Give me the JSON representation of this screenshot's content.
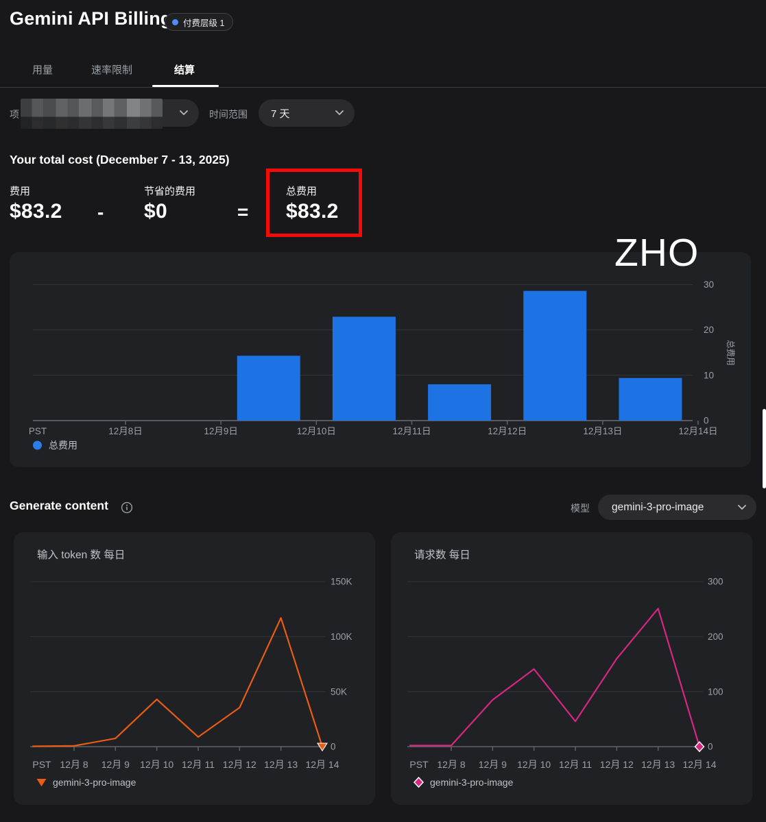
{
  "header": {
    "title": "Gemini API Billing",
    "badge_label": "付费层级 1",
    "badge_dot_color": "#4f8df7"
  },
  "tabs": [
    {
      "label": "用量",
      "active": false
    },
    {
      "label": "速率限制",
      "active": false
    },
    {
      "label": "结算",
      "active": true
    }
  ],
  "filters": {
    "project_label": "项目",
    "time_range_label": "时间范围",
    "time_range_value": "7 天"
  },
  "total_cost": {
    "heading": "Your total cost (December 7 - 13, 2025)",
    "cost_label": "费用",
    "cost_value": "$83.2",
    "minus": "-",
    "savings_label": "节省的费用",
    "savings_value": "$0",
    "equals": "=",
    "total_label": "总费用",
    "total_value": "$83.2",
    "highlight_color": "#f50a0a"
  },
  "watermark": "ZHO",
  "section": {
    "title": "Generate content",
    "model_label": "模型",
    "model_value": "gemini-3-pro-image"
  },
  "chart_data": [
    {
      "id": "cost-bar",
      "type": "bar",
      "title": "",
      "series_label": "总费用",
      "color": "#1d72e4",
      "legend_color": "#2b7de9",
      "tz_label": "PST",
      "x_tick_labels": [
        "12月8日",
        "12月9日",
        "12月10日",
        "12月11日",
        "12月12日",
        "12月13日",
        "12月14日"
      ],
      "bars": [
        {
          "between": [
            "PST",
            "12月8日"
          ],
          "value": 0
        },
        {
          "between": [
            "12月8日",
            "12月9日"
          ],
          "value": 0
        },
        {
          "between": [
            "12月9日",
            "12月10日"
          ],
          "value": 14.3
        },
        {
          "between": [
            "12月10日",
            "12月11日"
          ],
          "value": 22.9
        },
        {
          "between": [
            "12月11日",
            "12月12日"
          ],
          "value": 8.0
        },
        {
          "between": [
            "12月12日",
            "12月13日"
          ],
          "value": 28.6
        },
        {
          "between": [
            "12月13日",
            "12月14日"
          ],
          "value": 9.4
        }
      ],
      "y_tick_values": [
        0,
        10,
        20,
        30
      ],
      "y_tick_labels": [
        "0",
        "10",
        "20",
        "30"
      ],
      "ylim": [
        0,
        33
      ],
      "y_axis_title": "总费用",
      "grid": true,
      "legend_position": "bottom-left",
      "legend": [
        {
          "label": "总费用",
          "marker": "circle"
        }
      ]
    },
    {
      "id": "input-tokens",
      "type": "line",
      "title": "输入 token 数 每日",
      "color": "#ea5c14",
      "marker": "triangle-down",
      "tz_label": "PST",
      "x_tick_labels": [
        "12月 8",
        "12月 9",
        "12月 10",
        "12月 11",
        "12月 12",
        "12月 13",
        "12月 14"
      ],
      "points": [
        {
          "x": "PST",
          "y": 300
        },
        {
          "x": "12月 8",
          "y": 700
        },
        {
          "x": "12月 9",
          "y": 7500
        },
        {
          "x": "12月 10",
          "y": 43000
        },
        {
          "x": "12月 11",
          "y": 8800
        },
        {
          "x": "12月 12",
          "y": 35500
        },
        {
          "x": "12月 13",
          "y": 117000
        },
        {
          "x": "12月 14",
          "y": 0
        }
      ],
      "y_tick_values": [
        0,
        50000,
        100000,
        150000
      ],
      "y_tick_labels": [
        "0",
        "50K",
        "100K",
        "150K"
      ],
      "ylim": [
        0,
        160000
      ],
      "grid": true,
      "legend_position": "bottom-left",
      "legend": [
        {
          "label": "gemini-3-pro-image",
          "marker": "triangle-down"
        }
      ]
    },
    {
      "id": "requests",
      "type": "line",
      "title": "请求数 每日",
      "color": "#d62783",
      "marker": "diamond",
      "tz_label": "PST",
      "x_tick_labels": [
        "12月 8",
        "12月 9",
        "12月 10",
        "12月 11",
        "12月 12",
        "12月 13",
        "12月 14"
      ],
      "points": [
        {
          "x": "PST",
          "y": 2
        },
        {
          "x": "12月 8",
          "y": 2
        },
        {
          "x": "12月 9",
          "y": 85
        },
        {
          "x": "12月 10",
          "y": 141
        },
        {
          "x": "12月 11",
          "y": 46
        },
        {
          "x": "12月 12",
          "y": 160
        },
        {
          "x": "12月 13",
          "y": 251
        },
        {
          "x": "12月 14",
          "y": 0
        }
      ],
      "y_tick_values": [
        0,
        100,
        200,
        300
      ],
      "y_tick_labels": [
        "0",
        "100",
        "200",
        "300"
      ],
      "ylim": [
        0,
        320
      ],
      "grid": true,
      "legend_position": "bottom-left",
      "legend": [
        {
          "label": "gemini-3-pro-image",
          "marker": "diamond"
        }
      ]
    }
  ]
}
